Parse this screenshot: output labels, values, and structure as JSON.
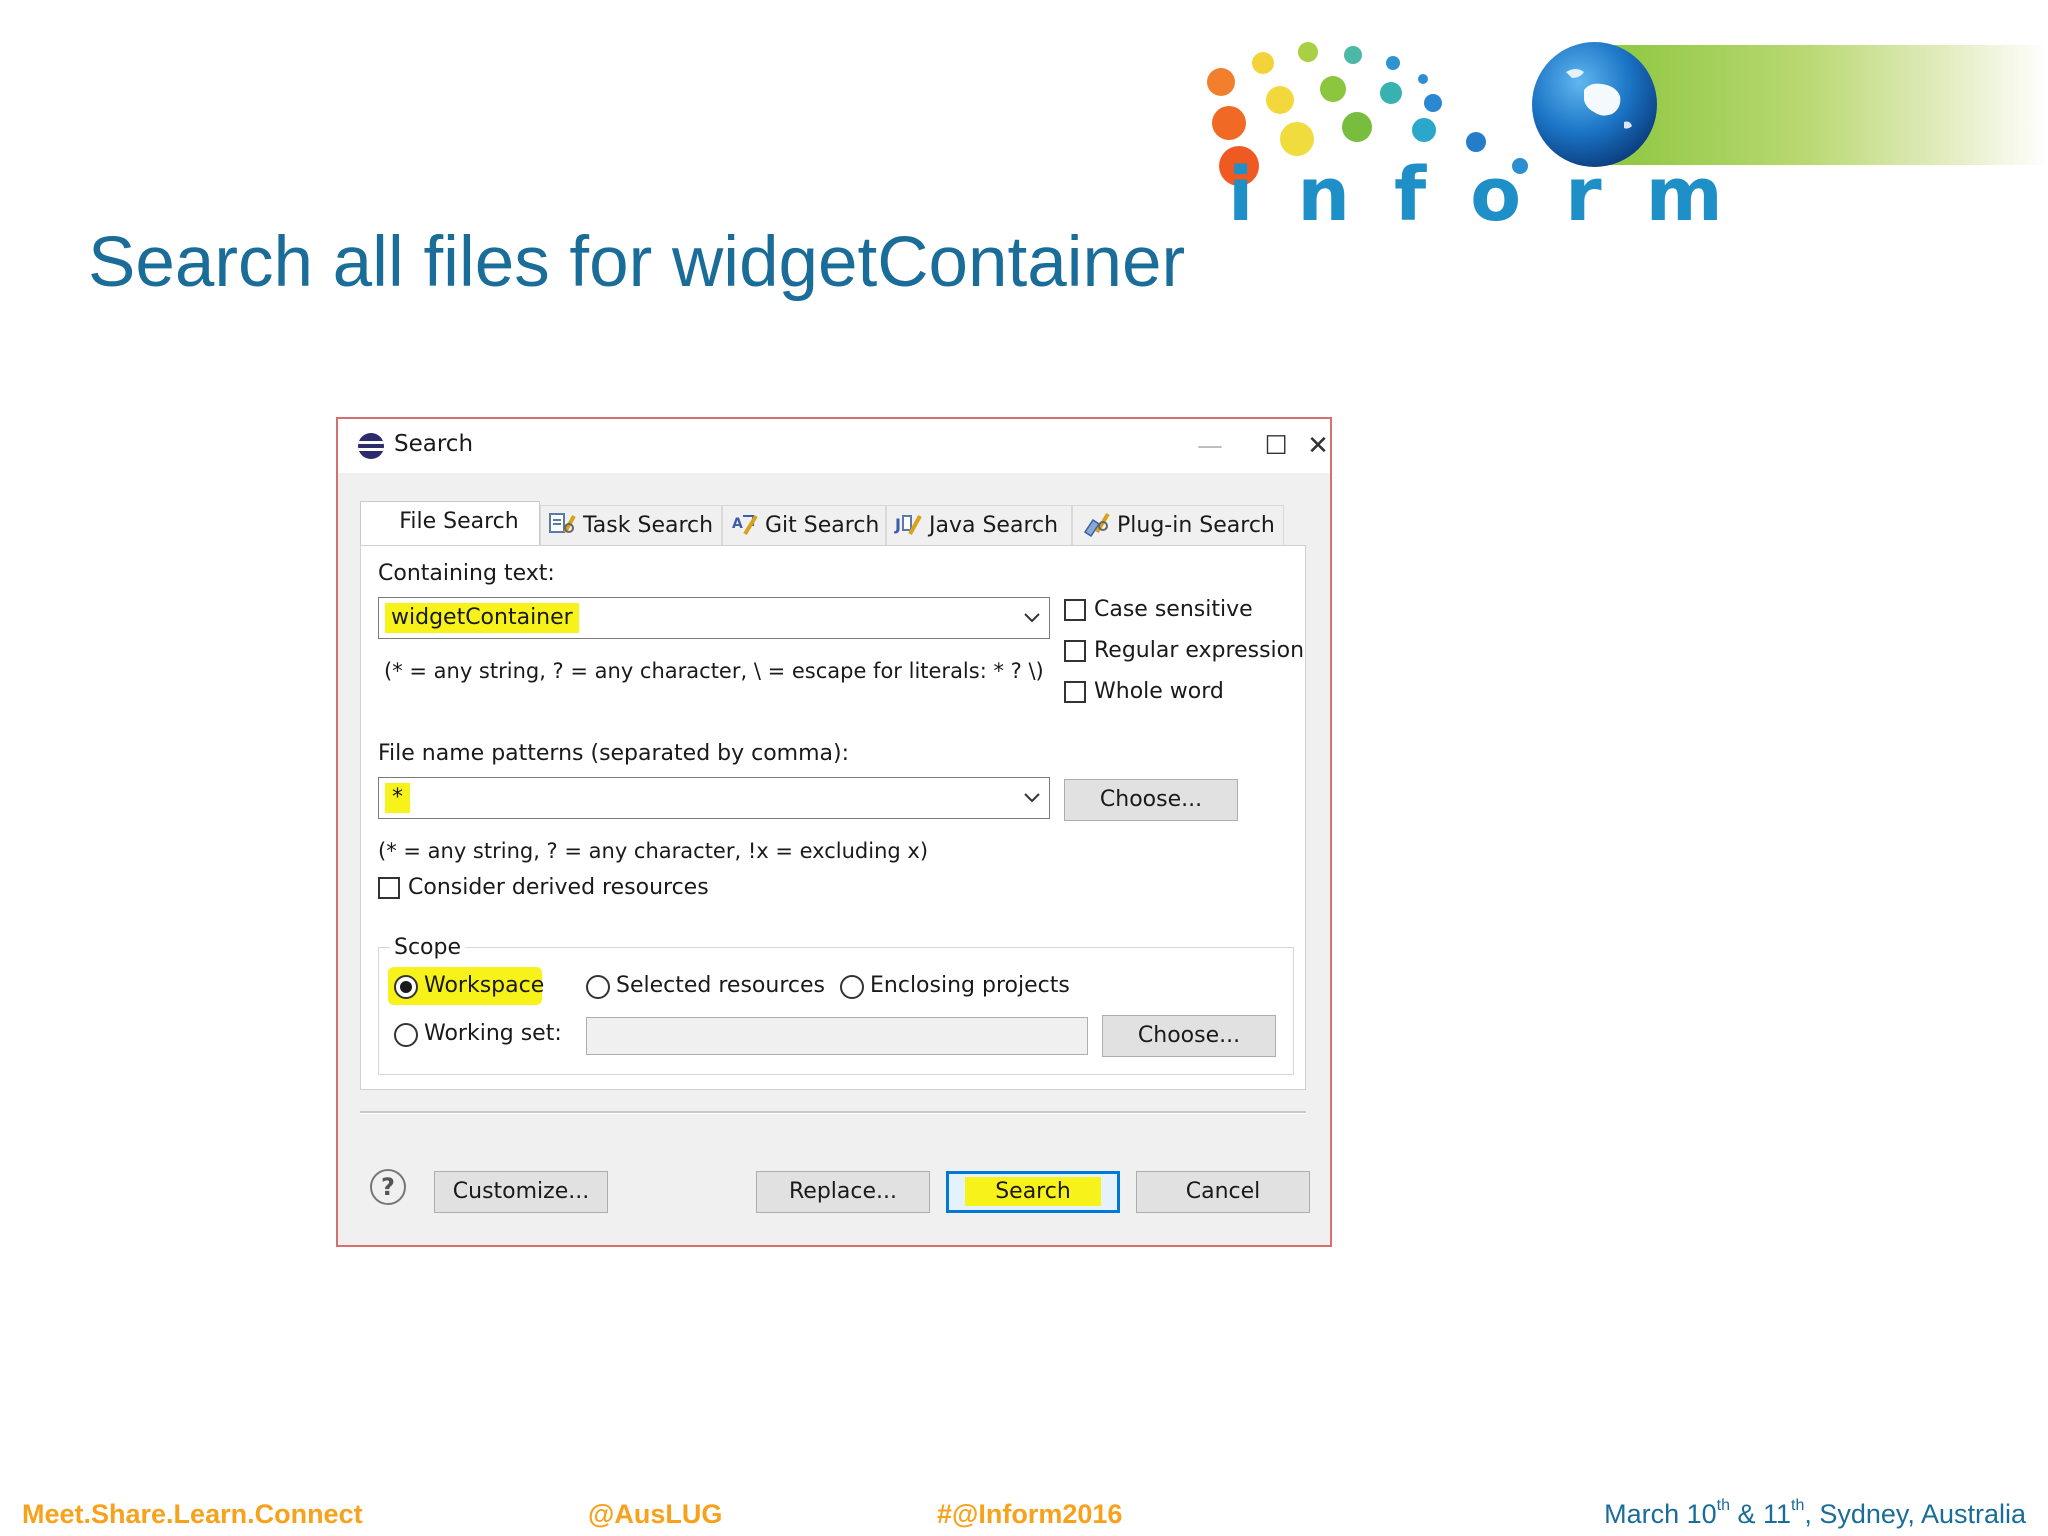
{
  "slide": {
    "title": "Search all files for widgetContainer",
    "logo_word": "inform"
  },
  "dialog": {
    "title": "Search",
    "window_buttons": {
      "minimize": "—",
      "maximize": "☐",
      "close": "✕"
    },
    "tabs": [
      {
        "label": "File Search",
        "active": true
      },
      {
        "label": "Task Search",
        "active": false
      },
      {
        "label": "Git Search",
        "active": false
      },
      {
        "label": "Java Search",
        "active": false
      },
      {
        "label": "Plug-in Search",
        "active": false
      }
    ],
    "containing_text": {
      "label": "Containing text:",
      "value": "widgetContainer",
      "hint": "(* = any string, ? = any character, \\ = escape for literals: * ? \\)"
    },
    "options": {
      "case_sensitive": {
        "label": "Case sensitive",
        "checked": false
      },
      "regular_expression": {
        "label": "Regular expression",
        "checked": false
      },
      "whole_word": {
        "label": "Whole word",
        "checked": false
      }
    },
    "file_name_patterns": {
      "label": "File name patterns (separated by comma):",
      "value": "*",
      "hint": "(* = any string, ? = any character, !x = excluding x)",
      "choose_label": "Choose..."
    },
    "consider_derived": {
      "label": "Consider derived resources",
      "checked": false
    },
    "scope": {
      "label": "Scope",
      "workspace": {
        "label": "Workspace",
        "selected": true
      },
      "selected_resources": {
        "label": "Selected resources",
        "selected": false
      },
      "enclosing_projects": {
        "label": "Enclosing projects",
        "selected": false
      },
      "working_set": {
        "label": "Working set:",
        "selected": false,
        "value": ""
      },
      "choose_label": "Choose..."
    },
    "buttons": {
      "help": "?",
      "customize": "Customize...",
      "replace": "Replace...",
      "search": "Search",
      "cancel": "Cancel"
    },
    "highlight_color": "#f7f21a"
  },
  "footer": {
    "tagline": "Meet.Share.Learn.Connect",
    "handle": "@AusLUG",
    "hashtag": "#@Inform2016",
    "date_a": "March 10",
    "date_sup1": "th",
    "date_b": " & 11",
    "date_sup2": "th",
    "date_c": ", Sydney, Australia"
  }
}
